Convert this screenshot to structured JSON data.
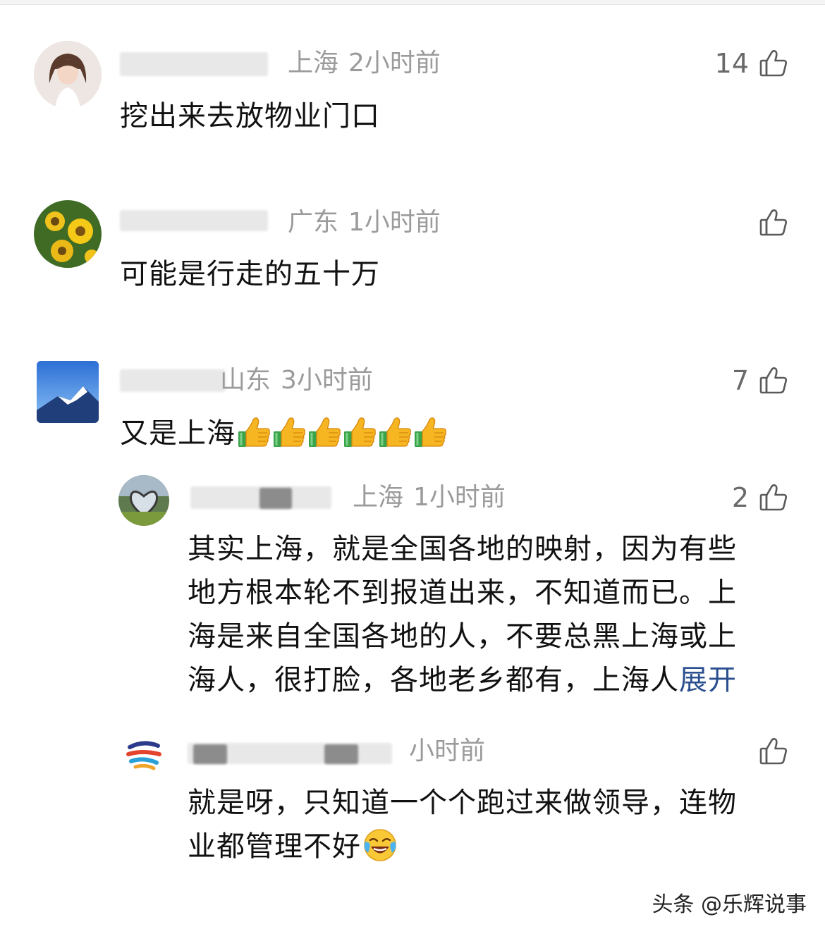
{
  "comments": [
    {
      "location": "上海",
      "time": "2小时前",
      "likes": "14",
      "text": "挖出来去放物业门口"
    },
    {
      "location": "广东",
      "time": "1小时前",
      "likes": "",
      "text": "可能是行走的五十万"
    },
    {
      "location": "山东",
      "time": "3小时前",
      "likes": "7",
      "text": "又是上海"
    }
  ],
  "replies": [
    {
      "location": "上海",
      "time": "1小时前",
      "likes": "2",
      "text_lines": [
        "其实上海，就是全国各地的映射，因为有些",
        "地方根本轮不到报道出来，不知道而已。上",
        "海是来自全国各地的人，不要总黑上海或上",
        "海人，很打脸，各地老乡都有，上海人"
      ],
      "expand_label": "展开"
    },
    {
      "time": "小时前",
      "likes": "",
      "text_lines": [
        "就是呀，只知道一个个跑过来做领导，连物",
        "业都管理不好"
      ]
    }
  ],
  "icons": {
    "like": "thumbs-up-outline-icon",
    "emoji_thumb": "thumbs-up-emoji",
    "emoji_face": "rofl-emoji"
  },
  "watermark": "头条 @乐辉说事",
  "colors": {
    "meta_text": "#9b9b9b",
    "expand_link": "#2b4f8f",
    "body_text": "#111111"
  }
}
